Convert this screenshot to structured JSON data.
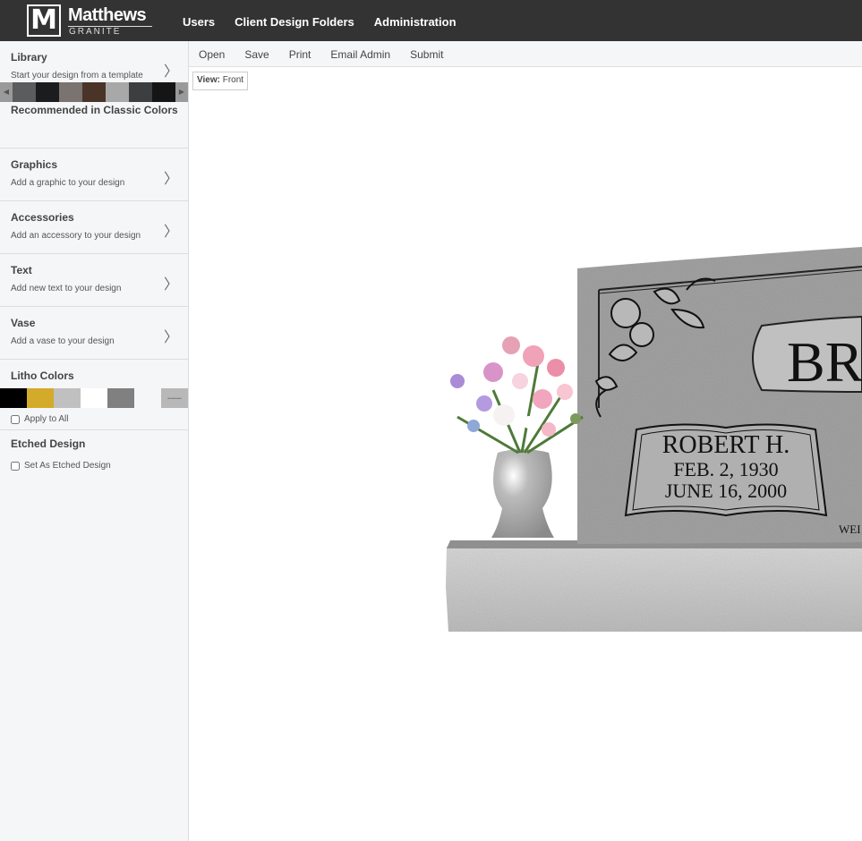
{
  "brand": {
    "name": "Matthews",
    "sub": "GRANITE",
    "mark": "M"
  },
  "nav": [
    "Users",
    "Client Design Folders",
    "Administration"
  ],
  "sidebar": {
    "library": {
      "title": "Library",
      "desc": "Start your design from a template"
    },
    "recommended": {
      "title": "Recommended in Classic Colors",
      "swatches": [
        "#5a5c5e",
        "#1b1c1e",
        "#7b7370",
        "#4a3427",
        "#a8a8a8",
        "#3c3e40",
        "#151515"
      ]
    },
    "graphics": {
      "title": "Graphics",
      "desc": "Add a graphic to your design"
    },
    "accessories": {
      "title": "Accessories",
      "desc": "Add an accessory to your design"
    },
    "text": {
      "title": "Text",
      "desc": "Add new text to your design"
    },
    "vase": {
      "title": "Vase",
      "desc": "Add a vase to your design"
    },
    "litho": {
      "title": "Litho Colors",
      "colors": [
        "#000000",
        "#d4aa2a",
        "#c0c0c0",
        "#ffffff",
        "#808080",
        "#f5f6f8",
        "#b8b8b8"
      ],
      "apply_all": "Apply to All"
    },
    "etched": {
      "title": "Etched Design",
      "checkbox": "Set As Etched Design"
    }
  },
  "toolbar": [
    "Open",
    "Save",
    "Print",
    "Email Admin",
    "Submit"
  ],
  "view": {
    "label": "View:",
    "value": "Front"
  },
  "monument": {
    "family_name": "BR",
    "person_name": "ROBERT H.",
    "birth": "FEB. 2, 1930",
    "death": "JUNE 16, 2000",
    "partial": "WEI"
  },
  "colors": {
    "topbar": "#333333",
    "sidebar": "#f5f6f8",
    "granite": "#9a9a9a"
  }
}
